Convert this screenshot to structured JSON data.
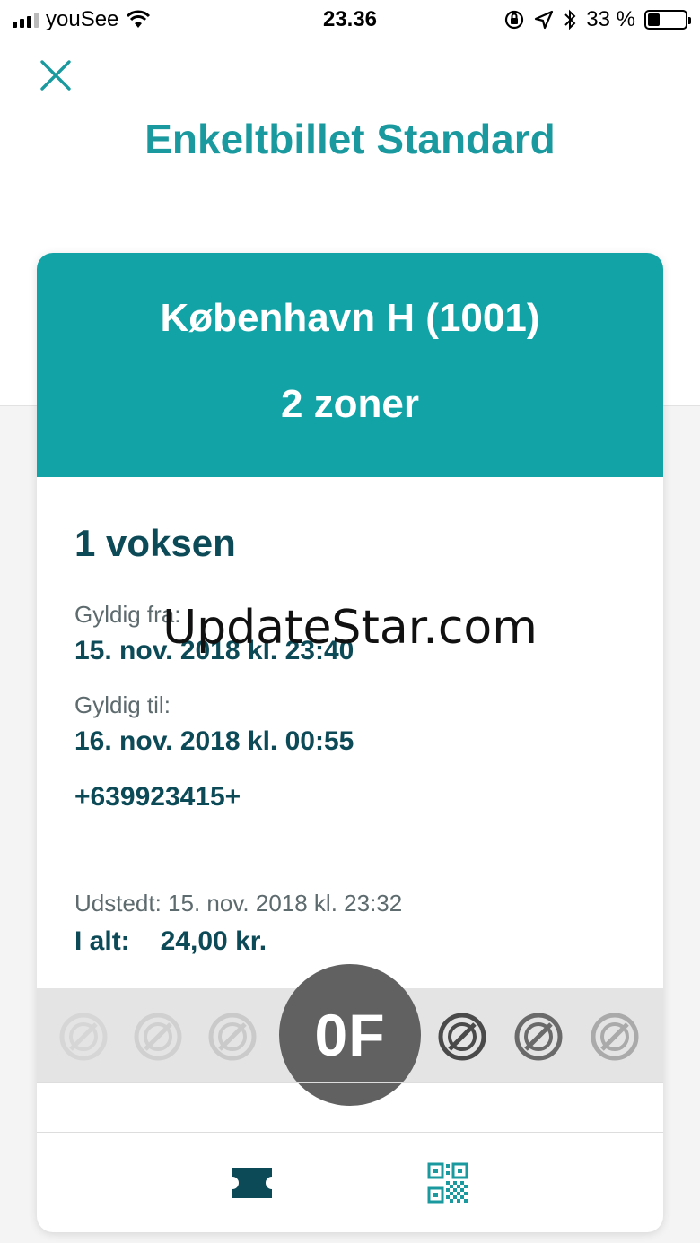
{
  "status_bar": {
    "carrier": "youSee",
    "time": "23.36",
    "battery_percent": "33 %",
    "battery_level": 0.33
  },
  "header": {
    "close_icon": "close-icon",
    "title": "Enkeltbillet Standard"
  },
  "ticket": {
    "station": "København H (1001)",
    "zones": "2 zoner",
    "passengers": "1 voksen",
    "valid_from_label": "Gyldig fra:",
    "valid_from": "15. nov. 2018 kl. 23:40",
    "valid_to_label": "Gyldig til:",
    "valid_to": "16. nov. 2018 kl. 00:55",
    "ticket_number": "+639923415+",
    "issued": "Udstedt: 15. nov. 2018 kl. 23:32",
    "total_label": "I alt:",
    "total_value": "24,00 kr.",
    "control_code": "0F"
  },
  "tabs": [
    {
      "name": "ticket-tab",
      "icon": "ticket-icon",
      "color": "#0d4a57"
    },
    {
      "name": "qr-tab",
      "icon": "qr-code-icon",
      "color": "#1a9a9f"
    }
  ],
  "watermark": "UpdateStar.com",
  "colors": {
    "accent": "#12a3a6",
    "title": "#1a9a9f",
    "text_dark": "#0d4a57",
    "badge": "#616161"
  }
}
